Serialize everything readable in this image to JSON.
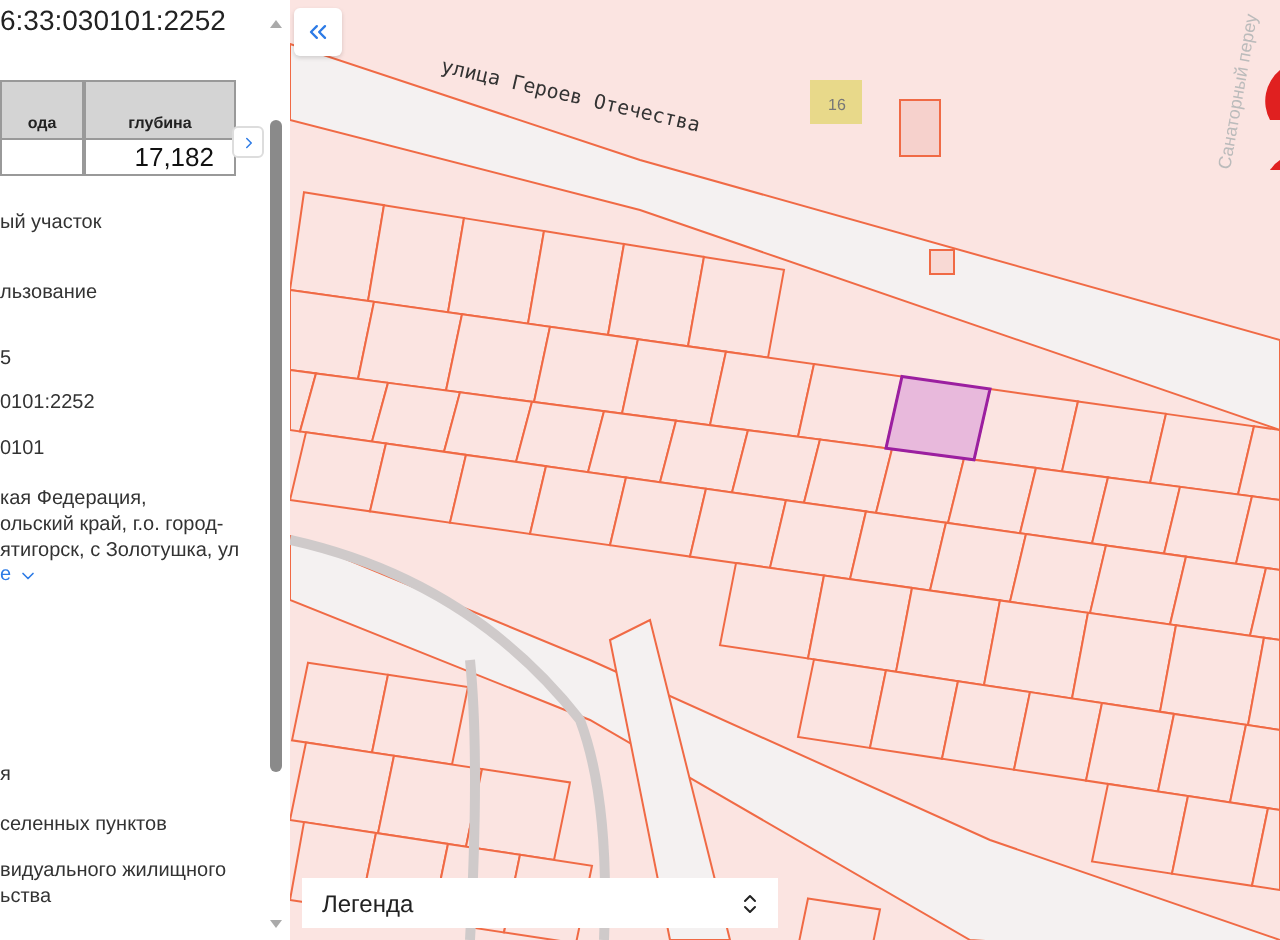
{
  "panel": {
    "title": "6:33:030101:2252",
    "table": {
      "columns": [
        "ода",
        "глубина"
      ],
      "row": {
        "column_2": "17,182"
      }
    },
    "fields": [
      {
        "lines": [
          "ый участок"
        ]
      },
      {
        "lines": [
          "льзование"
        ]
      },
      {
        "lines": [
          "5"
        ]
      },
      {
        "lines": [
          "0101:2252"
        ]
      },
      {
        "lines": [
          "0101"
        ]
      },
      {
        "lines": [
          "кая Федерация,",
          "ольский край, г.о. город-",
          "ятигорск, с Золотушка, ул"
        ]
      }
    ],
    "more_link": "е",
    "fields_2": [
      {
        "lines": [
          "я"
        ]
      },
      {
        "lines": [
          "селенных пунктов"
        ]
      },
      {
        "lines": [
          "видуального жилищного",
          "ьства"
        ]
      }
    ]
  },
  "map": {
    "street_label": "улица Героев Отечества",
    "house_number": "16",
    "side_street_label": "Санаторный переу",
    "legend": {
      "label": "Легенда"
    }
  }
}
